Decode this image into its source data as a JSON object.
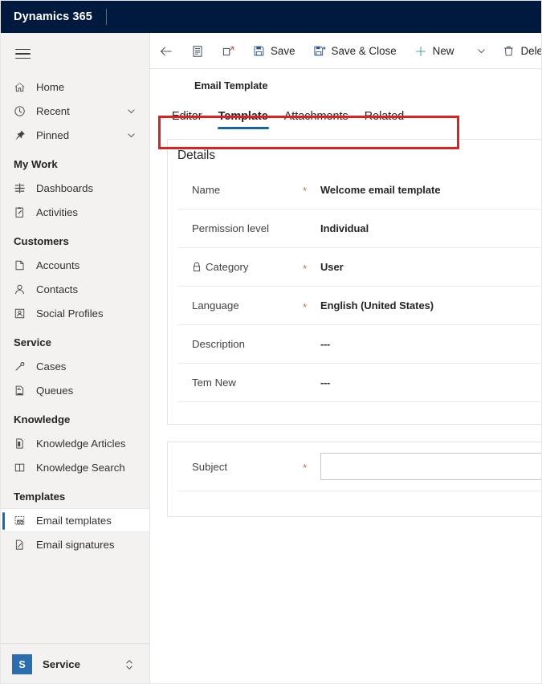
{
  "topbar": {
    "brand": "Dynamics 365"
  },
  "sidebar": {
    "hamburger_name": "site-map-toggle",
    "primary": [
      {
        "label": "Home",
        "icon": "home-icon",
        "chevron": false
      },
      {
        "label": "Recent",
        "icon": "clock-icon",
        "chevron": true
      },
      {
        "label": "Pinned",
        "icon": "pin-icon",
        "chevron": true
      }
    ],
    "groups": [
      {
        "title": "My Work",
        "items": [
          {
            "label": "Dashboards",
            "icon": "dashboard-icon"
          },
          {
            "label": "Activities",
            "icon": "activities-icon"
          }
        ]
      },
      {
        "title": "Customers",
        "items": [
          {
            "label": "Accounts",
            "icon": "account-icon"
          },
          {
            "label": "Contacts",
            "icon": "contact-icon"
          },
          {
            "label": "Social Profiles",
            "icon": "social-profile-icon"
          }
        ]
      },
      {
        "title": "Service",
        "items": [
          {
            "label": "Cases",
            "icon": "case-icon"
          },
          {
            "label": "Queues",
            "icon": "queue-icon"
          }
        ]
      },
      {
        "title": "Knowledge",
        "items": [
          {
            "label": "Knowledge Articles",
            "icon": "knowledge-article-icon"
          },
          {
            "label": "Knowledge Search",
            "icon": "knowledge-search-icon"
          }
        ]
      },
      {
        "title": "Templates",
        "items": [
          {
            "label": "Email templates",
            "icon": "email-template-icon",
            "selected": true
          },
          {
            "label": "Email signatures",
            "icon": "email-signature-icon",
            "selected": false
          }
        ]
      }
    ],
    "app_switcher": {
      "badge": "S",
      "name": "Service",
      "icon": "expand-collapse-icon"
    }
  },
  "command_bar": {
    "back": {
      "name": "back-button",
      "icon": "arrow-left-icon"
    },
    "form_selector": {
      "name": "form-selector-button",
      "icon": "form-icon"
    },
    "popout": {
      "name": "open-in-new-window-button",
      "icon": "popout-icon"
    },
    "save_label": "Save",
    "save_close_label": "Save & Close",
    "new_label": "New",
    "delete_label": "Delete",
    "overflow_icon": "chevron-down-icon"
  },
  "content": {
    "entity_name": "Email Template",
    "tabs": [
      {
        "label": "Editor",
        "active": false
      },
      {
        "label": "Template",
        "active": true
      },
      {
        "label": "Attachments",
        "active": false
      },
      {
        "label": "Related",
        "active": false
      }
    ],
    "details": {
      "title": "Details",
      "fields": [
        {
          "label": "Name",
          "required": true,
          "value": "Welcome email template",
          "locked": false
        },
        {
          "label": "Permission level",
          "required": false,
          "value": "Individual",
          "locked": false
        },
        {
          "label": "Category",
          "required": true,
          "value": "User",
          "locked": true
        },
        {
          "label": "Language",
          "required": true,
          "value": "English (United States)",
          "locked": false
        },
        {
          "label": "Description",
          "required": false,
          "value": "---",
          "locked": false
        },
        {
          "label": "Tem New",
          "required": false,
          "value": "---",
          "locked": false
        }
      ]
    },
    "subject": {
      "label": "Subject",
      "required": true,
      "value": "",
      "placeholder": ""
    }
  },
  "annotation": {
    "name": "tab-bar-highlight",
    "color": "#e02020"
  },
  "colors": {
    "header_bg": "#001a3f",
    "sidebar_bg": "#f3f2f1",
    "accent_blue": "#1264a3",
    "required_red": "#e8604c",
    "new_green": "#5bbd86",
    "annotation_red": "#e02020"
  }
}
